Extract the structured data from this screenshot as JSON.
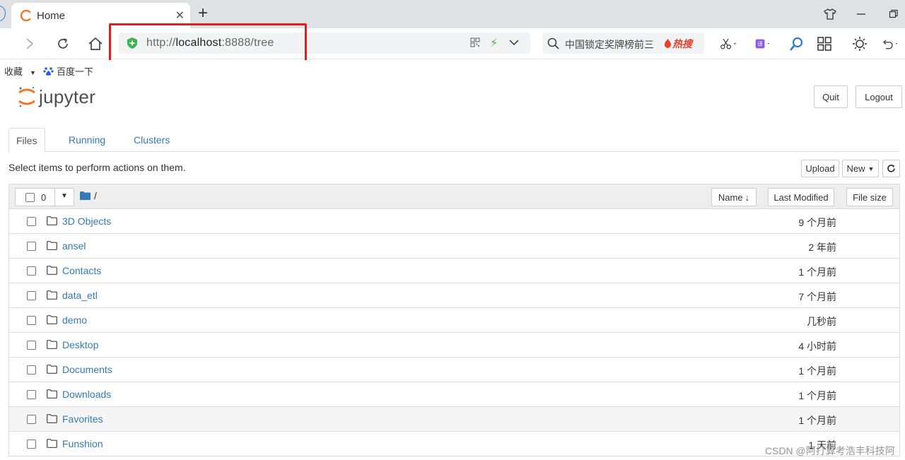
{
  "browser": {
    "tab_title": "Home",
    "url_prefix": "http://",
    "url_host": "localhost",
    "url_rest": ":8888/tree",
    "search_text": "中国锁定奖牌榜前三",
    "search_hot": "热搜"
  },
  "bookmarks": [
    {
      "label": "收藏"
    },
    {
      "label": "百度一下"
    }
  ],
  "header": {
    "logo_text": "jupyter",
    "quit_label": "Quit",
    "logout_label": "Logout"
  },
  "tabs": [
    {
      "label": "Files"
    },
    {
      "label": "Running"
    },
    {
      "label": "Clusters"
    }
  ],
  "toolbar": {
    "hint": "Select items to perform actions on them.",
    "upload_label": "Upload",
    "new_label": "New"
  },
  "list_header": {
    "selected_count": "0",
    "path": "/",
    "col_name": "Name",
    "col_modified": "Last Modified",
    "col_size": "File size"
  },
  "rows": [
    {
      "name": "3D Objects",
      "modified": "9 个月前"
    },
    {
      "name": "ansel",
      "modified": "2 年前"
    },
    {
      "name": "Contacts",
      "modified": "1 个月前"
    },
    {
      "name": "data_etl",
      "modified": "7 个月前"
    },
    {
      "name": "demo",
      "modified": "几秒前"
    },
    {
      "name": "Desktop",
      "modified": "4 小时前"
    },
    {
      "name": "Documents",
      "modified": "1 个月前"
    },
    {
      "name": "Downloads",
      "modified": "1 个月前"
    },
    {
      "name": "Favorites",
      "modified": "1 个月前"
    },
    {
      "name": "Funshion",
      "modified": "1 天前"
    }
  ],
  "watermark": "CSDN @阿打算考浩丰科技阿",
  "colors": {
    "link": "#337ab7",
    "jupyter_orange": "#f37726",
    "highlight_red": "#e0201c",
    "shield_green": "#3bb54a"
  }
}
